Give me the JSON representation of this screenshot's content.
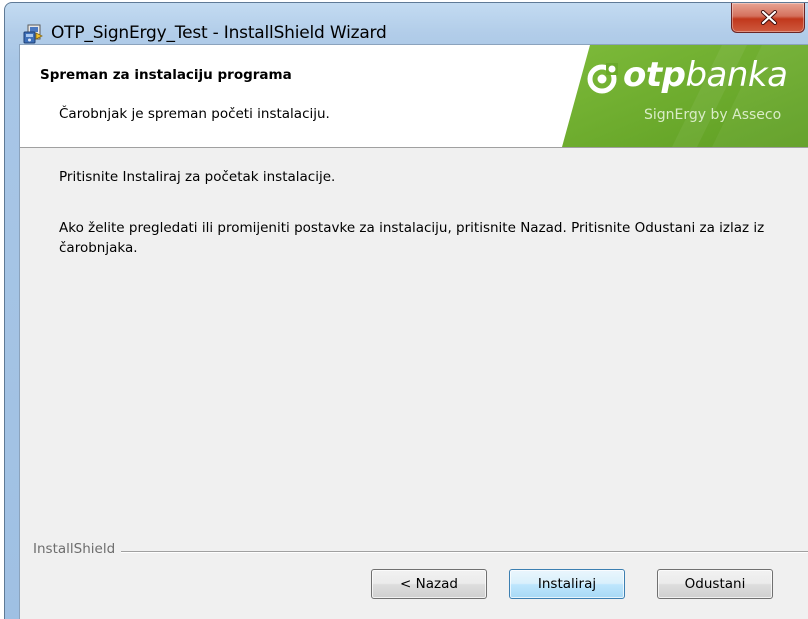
{
  "window": {
    "title": "OTP_SignErgy_Test - InstallShield Wizard",
    "app_icon": "installer-icon",
    "close_icon": "close-icon"
  },
  "header": {
    "title": "Spreman za instalaciju programa",
    "subtitle": "Čarobnjak je spreman početi instalaciju.",
    "logo": {
      "brand_bold": "otp",
      "brand_regular": "banka",
      "tagline": "SignErgy by Asseco"
    }
  },
  "body": {
    "paragraph1": "Pritisnite Instaliraj za početak instalacije.",
    "paragraph2": "Ako želite pregledati ili promijeniti postavke za instalaciju, pritisnite Nazad. Pritisnite Odustani za izlaz iz čarobnjaka."
  },
  "footer": {
    "brand": "InstallShield",
    "back_label": "< Nazad",
    "install_label": "Instaliraj",
    "cancel_label": "Odustani"
  },
  "colors": {
    "logo_green": "#6aaa2a",
    "close_red": "#c1381c",
    "default_button_border": "#3c7fb1"
  }
}
